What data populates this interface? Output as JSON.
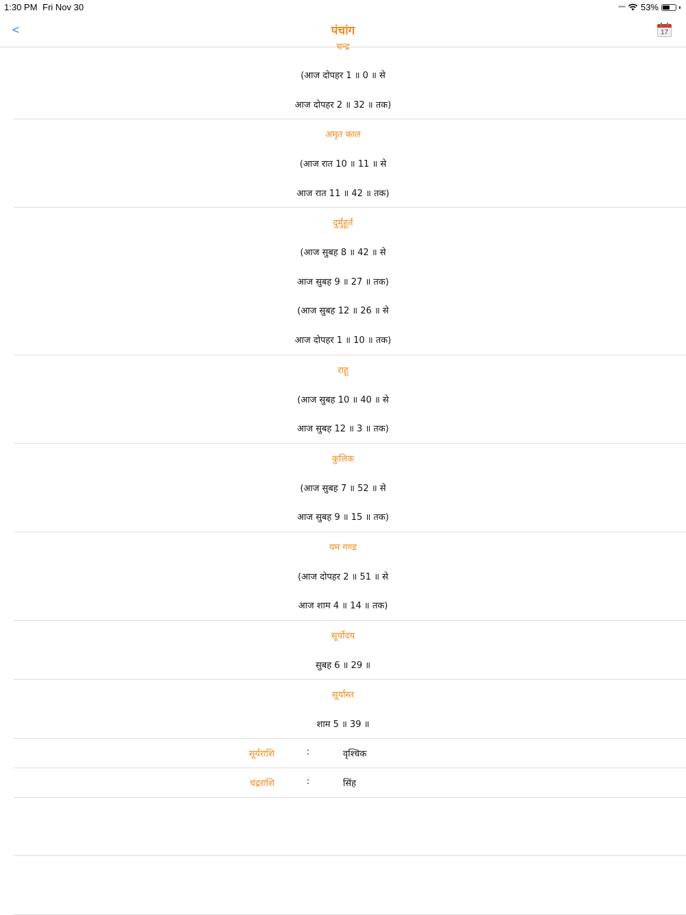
{
  "status_bar": {
    "time": "1:30 PM",
    "date": "Fri Nov 30",
    "signal": "••••",
    "battery_percent": "53%",
    "battery_level": 0.53
  },
  "nav": {
    "back_label": "<",
    "title": "पंचांग",
    "calendar_day": "17"
  },
  "sections": [
    {
      "heading": "चन्द्र",
      "lines": [
        "(आज दोपहर 1 ॥ 0 ॥ से",
        "आज दोपहर 2 ॥ 32 ॥ तक)"
      ]
    },
    {
      "heading": "अमृत काल",
      "lines": [
        "(आज रात 10 ॥ 11 ॥ से",
        "आज रात 11 ॥ 42 ॥ तक)"
      ]
    },
    {
      "heading": "दुर्मुहूर्त",
      "lines": [
        "(आज सुबह 8 ॥ 42 ॥ से",
        "आज सुबह 9 ॥ 27 ॥ तक)",
        "(आज सुबह 12 ॥ 26 ॥ से",
        "आज दोपहर 1 ॥ 10 ॥ तक)"
      ]
    },
    {
      "heading": "राहू",
      "lines": [
        "(आज सुबह 10 ॥ 40 ॥ से",
        "आज सुबह 12 ॥ 3 ॥ तक)"
      ]
    },
    {
      "heading": "कुलिक",
      "lines": [
        "(आज सुबह 7 ॥ 52 ॥ से",
        "आज सुबह 9 ॥ 15 ॥ तक)"
      ]
    },
    {
      "heading": "यम गण्ड",
      "lines": [
        "(आज दोपहर 2 ॥ 51 ॥ से",
        "आज शाम 4 ॥ 14 ॥ तक)"
      ]
    },
    {
      "heading": "सूर्योदय",
      "lines": [
        "सुबह 6 ॥ 29 ॥"
      ]
    },
    {
      "heading": "सूर्यास्त",
      "lines": [
        "शाम 5 ॥ 39 ॥"
      ]
    }
  ],
  "rashi": [
    {
      "label": "सूर्यराशि",
      "colon": ":",
      "value": "वृश्चिक"
    },
    {
      "label": "चंद्रराशि",
      "colon": ":",
      "value": "सिंह"
    }
  ],
  "colors": {
    "accent_orange": "#f08a1c",
    "link_blue": "#1e7cf2"
  }
}
